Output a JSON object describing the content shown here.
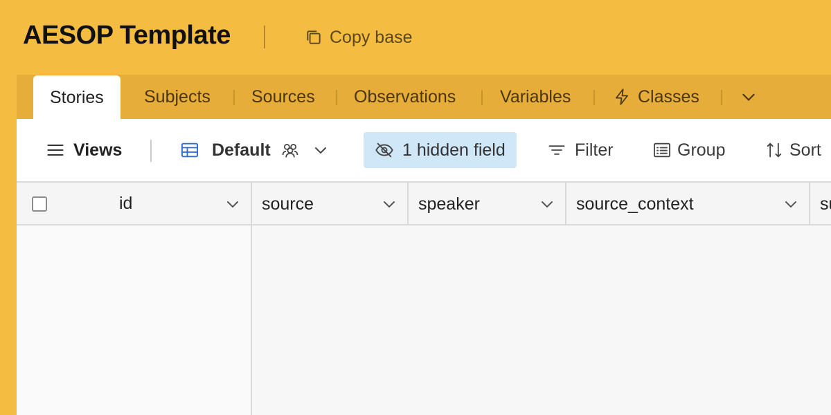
{
  "header": {
    "title": "AESOP Template",
    "copy_label": "Copy base"
  },
  "tabs": [
    {
      "label": "Stories",
      "active": true
    },
    {
      "label": "Subjects"
    },
    {
      "label": "Sources"
    },
    {
      "label": "Observations"
    },
    {
      "label": "Variables"
    },
    {
      "label": "Classes",
      "icon": "lightning-icon"
    }
  ],
  "toolbar": {
    "views_label": "Views",
    "view_name": "Default",
    "hidden_label": "1 hidden field",
    "filter_label": "Filter",
    "group_label": "Group",
    "sort_label": "Sort"
  },
  "columns": [
    "id",
    "source",
    "speaker",
    "source_context",
    "su"
  ],
  "colors": {
    "header_bg": "#f5bc42",
    "tabbar_bg": "#e6ad39",
    "hidden_field_bg": "#cfe7f7",
    "table_icon": "#2d6bd3"
  }
}
